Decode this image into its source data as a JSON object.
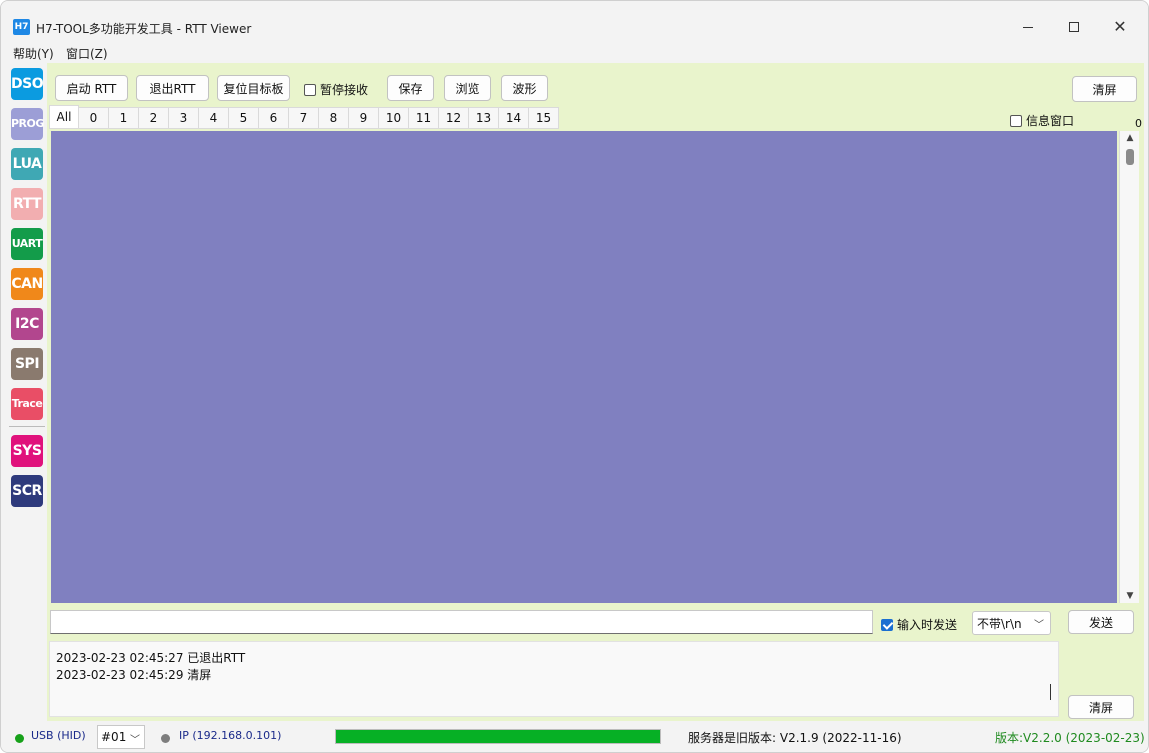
{
  "window": {
    "app_icon": "H7",
    "title": "H7-TOOL多功能开发工具 - RTT Viewer"
  },
  "menu": [
    {
      "label": "帮助(Y)"
    },
    {
      "label": "窗口(Z)"
    }
  ],
  "sidebar": [
    {
      "label": "DSO",
      "color": "#0b9be0"
    },
    {
      "label": "PROG",
      "color": "#9c9ed6"
    },
    {
      "label": "LUA",
      "color": "#3fa8b4"
    },
    {
      "label": "RTT",
      "color": "#f2aeb0"
    },
    {
      "label": "UART",
      "color": "#139c4a"
    },
    {
      "label": "CAN",
      "color": "#f0881a"
    },
    {
      "label": "I2C",
      "color": "#b2468e"
    },
    {
      "label": "SPI",
      "color": "#8a7a6e"
    },
    {
      "label": "Trace",
      "color": "#e94e66"
    },
    {
      "label": "SYS",
      "color": "#e0127c"
    },
    {
      "label": "SCR",
      "color": "#2e3a7c"
    }
  ],
  "toolbar": {
    "start_rtt": "启动 RTT",
    "exit_rtt": "退出RTT",
    "reset_target": "复位目标板",
    "pause_receive": "暂停接收",
    "save": "保存",
    "browse": "浏览",
    "waveform": "波形",
    "clear": "清屏",
    "info_window": "信息窗口"
  },
  "tabs": [
    "All",
    "0",
    "1",
    "2",
    "3",
    "4",
    "5",
    "6",
    "7",
    "8",
    "9",
    "10",
    "11",
    "12",
    "13",
    "14",
    "15"
  ],
  "counter": "0",
  "terminal_color": "#8080c0",
  "send_row": {
    "input_value": "",
    "send_on_input": "输入时发送",
    "line_ending": "不带\\r\\n",
    "send": "发送"
  },
  "log": {
    "lines": [
      "2023-02-23 02:45:27 已退出RTT",
      "2023-02-23 02:45:29 清屏"
    ],
    "clear": "清屏"
  },
  "status": {
    "usb": "USB (HID)",
    "device": "#01",
    "ip": "IP (192.168.0.101)",
    "progress": 1.0,
    "server_version": "服务器是旧版本: V2.1.9 (2022-11-16)",
    "version": "版本:V2.2.0 (2023-02-23)"
  }
}
